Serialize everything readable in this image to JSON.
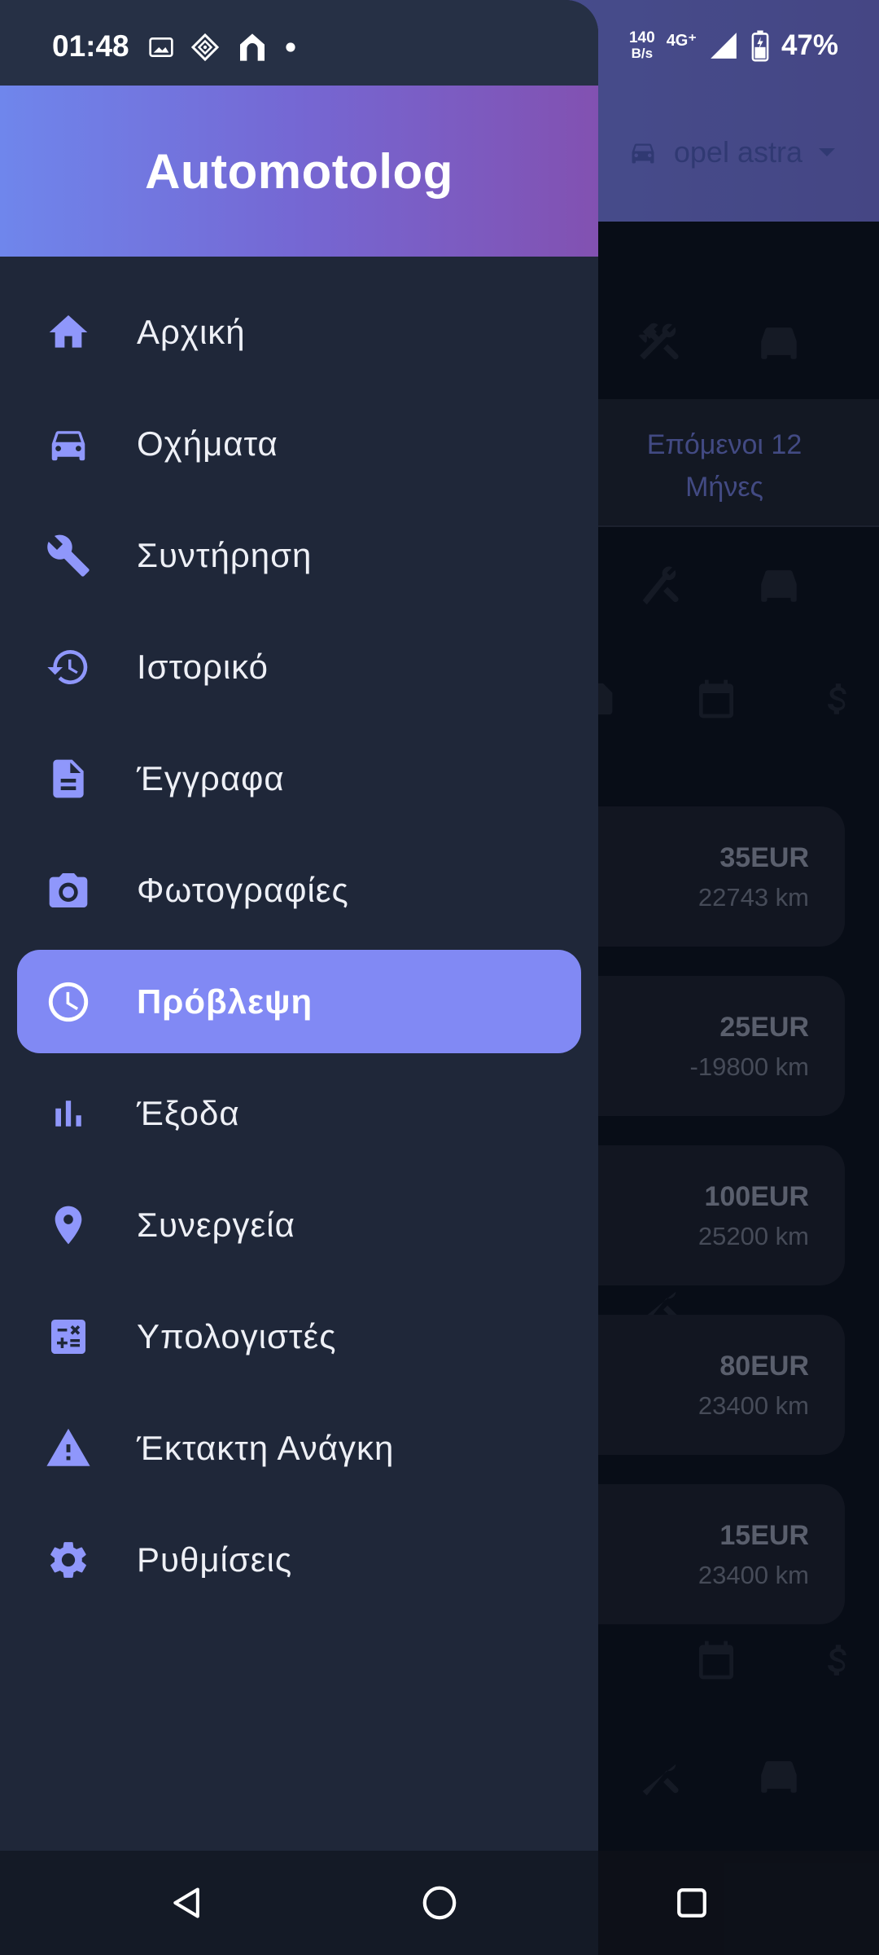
{
  "status_bar": {
    "time": "01:48",
    "net_speed_value": "140",
    "net_speed_unit": "B/s",
    "network_type": "4G⁺",
    "battery": "47%"
  },
  "background": {
    "vehicle_selector": "opel astra",
    "tab_next": "Επόμενοι 12 Μήνες",
    "cards": [
      {
        "price": "35EUR",
        "km": "22743 km"
      },
      {
        "price": "25EUR",
        "km": "-19800 km"
      },
      {
        "price": "100EUR",
        "km": "25200 km"
      },
      {
        "price": "80EUR",
        "km": "23400 km"
      },
      {
        "price": "15EUR",
        "km": "23400 km"
      }
    ]
  },
  "drawer": {
    "title": "Automotolog",
    "accent_color": "#8189f4",
    "icon_color": "#8f97fb",
    "items": [
      {
        "label": "Αρχική",
        "icon": "home-icon"
      },
      {
        "label": "Οχήματα",
        "icon": "car-icon"
      },
      {
        "label": "Συντήρηση",
        "icon": "wrench-icon"
      },
      {
        "label": "Ιστορικό",
        "icon": "history-icon"
      },
      {
        "label": "Έγγραφα",
        "icon": "document-icon"
      },
      {
        "label": "Φωτογραφίες",
        "icon": "camera-icon"
      },
      {
        "label": "Πρόβλεψη",
        "icon": "clock-icon",
        "active": true
      },
      {
        "label": "Έξοδα",
        "icon": "bar-chart-icon"
      },
      {
        "label": "Συνεργεία",
        "icon": "location-pin-icon"
      },
      {
        "label": "Υπολογιστές",
        "icon": "calculator-icon"
      },
      {
        "label": "Έκτακτη Ανάγκη",
        "icon": "warning-icon"
      },
      {
        "label": "Ρυθμίσεις",
        "icon": "gear-icon"
      }
    ]
  },
  "system_nav": {
    "back": "back-icon",
    "home": "home-circle-icon",
    "recents": "recents-icon"
  }
}
